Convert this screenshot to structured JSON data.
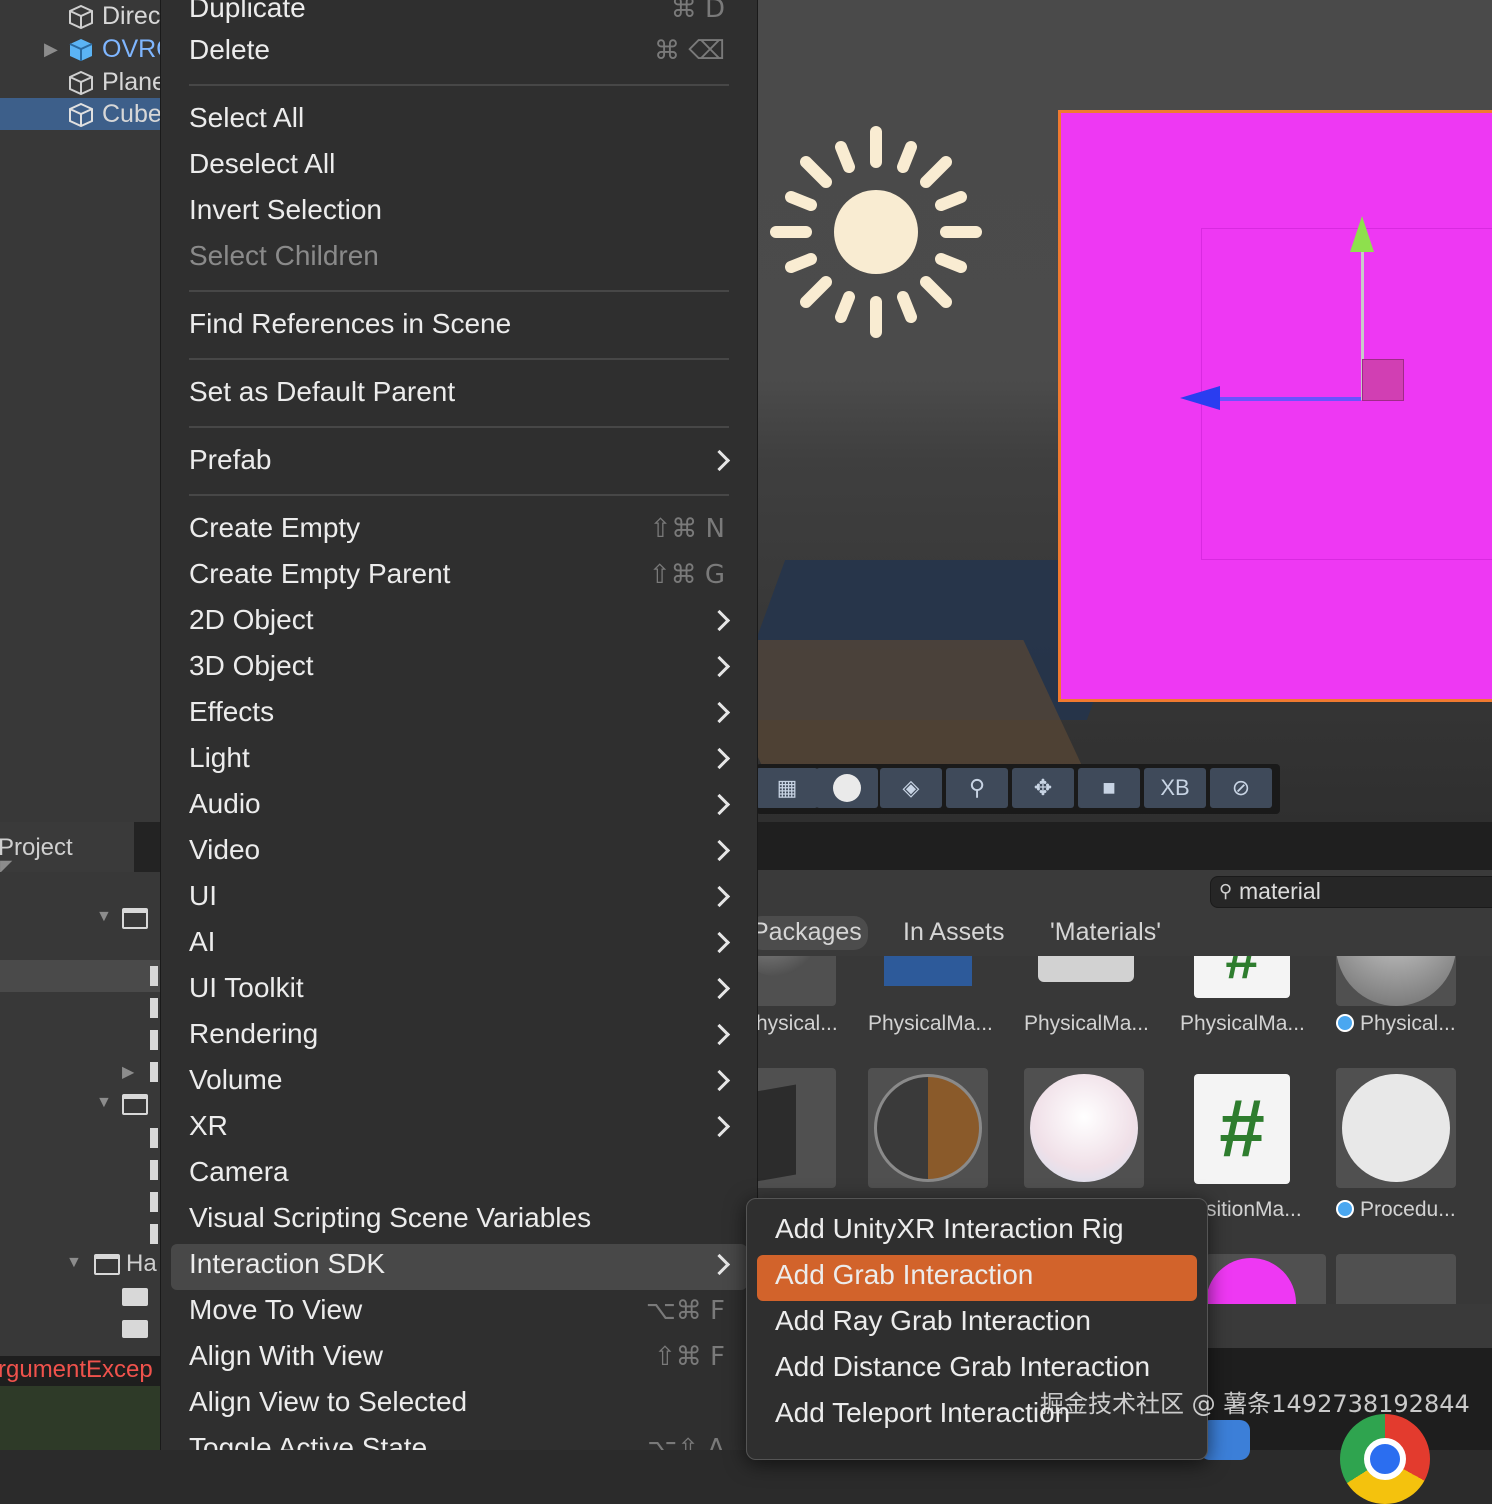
{
  "hierarchy": {
    "items": [
      {
        "label": "Direc",
        "icon": "cube-outline-icon"
      },
      {
        "label": "OVRC",
        "icon": "prefab-cube-icon"
      },
      {
        "label": "Plane",
        "icon": "cube-outline-icon"
      },
      {
        "label": "Cube",
        "icon": "cube-outline-icon"
      }
    ]
  },
  "project": {
    "tab_label": "Project",
    "tree_label_ha": "Ha"
  },
  "console": {
    "error_text": "rgumentExcep"
  },
  "context_menu": {
    "items": [
      {
        "label": "Duplicate",
        "shortcut": "⌘ D"
      },
      {
        "label": "Delete",
        "shortcut": "⌘ ⌫"
      },
      {
        "label": "Select All",
        "shortcut": ""
      },
      {
        "label": "Deselect All",
        "shortcut": ""
      },
      {
        "label": "Invert Selection",
        "shortcut": ""
      },
      {
        "label": "Select Children",
        "shortcut": "",
        "disabled": true
      },
      {
        "label": "Find References in Scene",
        "shortcut": ""
      },
      {
        "label": "Set as Default Parent",
        "shortcut": ""
      },
      {
        "label": "Prefab",
        "submenu": true
      },
      {
        "label": "Create Empty",
        "shortcut": "⇧⌘ N"
      },
      {
        "label": "Create Empty Parent",
        "shortcut": "⇧⌘ G"
      },
      {
        "label": "2D Object",
        "submenu": true
      },
      {
        "label": "3D Object",
        "submenu": true
      },
      {
        "label": "Effects",
        "submenu": true
      },
      {
        "label": "Light",
        "submenu": true
      },
      {
        "label": "Audio",
        "submenu": true
      },
      {
        "label": "Video",
        "submenu": true
      },
      {
        "label": "UI",
        "submenu": true
      },
      {
        "label": "AI",
        "submenu": true
      },
      {
        "label": "UI Toolkit",
        "submenu": true
      },
      {
        "label": "Rendering",
        "submenu": true
      },
      {
        "label": "Volume",
        "submenu": true
      },
      {
        "label": "XR",
        "submenu": true
      },
      {
        "label": "Camera",
        "shortcut": ""
      },
      {
        "label": "Visual Scripting Scene Variables",
        "shortcut": ""
      },
      {
        "label": "Interaction SDK",
        "submenu": true,
        "highlighted": true
      },
      {
        "label": "Move To View",
        "shortcut": "⌥⌘ F"
      },
      {
        "label": "Align With View",
        "shortcut": "⇧⌘ F"
      },
      {
        "label": "Align View to Selected",
        "shortcut": ""
      },
      {
        "label": "Toggle Active State",
        "shortcut": "⌥⇧ A"
      }
    ]
  },
  "submenu": {
    "items": [
      {
        "label": "Add UnityXR Interaction Rig"
      },
      {
        "label": "Add Grab Interaction",
        "active": true
      },
      {
        "label": "Add Ray Grab Interaction"
      },
      {
        "label": "Add Distance Grab Interaction"
      },
      {
        "label": "Add Teleport Interaction"
      }
    ]
  },
  "scene_toolbar": {
    "buttons": [
      {
        "icon": "grid-icon"
      },
      {
        "icon": "shading-sphere-icon"
      },
      {
        "icon": "layers-icon"
      },
      {
        "icon": "search-icon"
      },
      {
        "icon": "move-gizmo-icon"
      },
      {
        "icon": "camera-icon"
      },
      {
        "label": "XB"
      },
      {
        "icon": "compass-icon"
      }
    ]
  },
  "assets": {
    "search_value": "material",
    "filters": [
      "Packages",
      "In Assets",
      "'Materials'"
    ],
    "row1_labels": [
      "hysical...",
      "PhysicalMa...",
      "PhysicalMa...",
      "PhysicalMa...",
      "Physical..."
    ],
    "row2_labels": [
      "sitionMa...",
      "Procedu..."
    ],
    "script_glyph": "#"
  },
  "watermark": "掘金技术社区 @ 薯条1492738192844",
  "colors": {
    "cube": "#ee38f3",
    "selection_outline": "#f07a30",
    "submenu_active": "#d2632b",
    "hierarchy_selected": "#3d5f8a",
    "error_text": "#f0524c"
  }
}
